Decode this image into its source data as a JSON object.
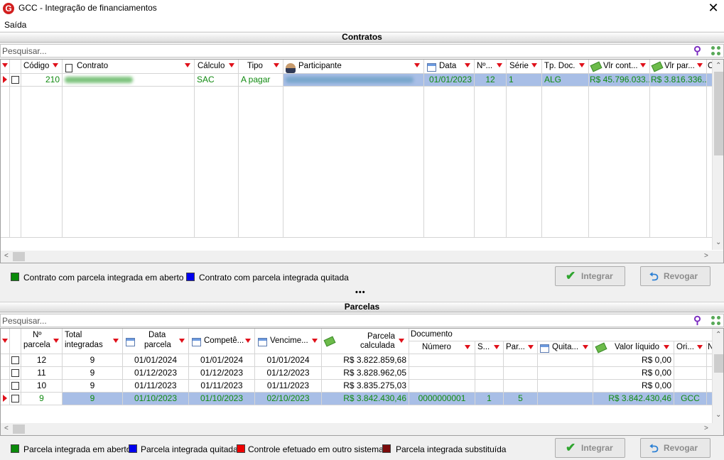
{
  "window": {
    "title": "GCC - Integração de financiamentos",
    "logo": "G",
    "close_icon": "close-icon"
  },
  "menu": {
    "saida": "Saída"
  },
  "contratos": {
    "section_title": "Contratos",
    "search_placeholder": "Pesquisar...",
    "columns": {
      "codigo": "Código",
      "contrato": "Contrato",
      "calculo": "Cálculo",
      "tipo": "Tipo",
      "participante": "Participante",
      "data": "Data",
      "num": "Nº...",
      "serie": "Série",
      "tpdoc": "Tp. Doc.",
      "vlrcont": "Vlr cont...",
      "vlrpar": "Vlr par...",
      "extra": "C"
    },
    "rows": [
      {
        "codigo": "210",
        "calculo": "SAC",
        "tipo": "A pagar",
        "data": "01/01/2023",
        "num": "12",
        "serie": "1",
        "tpdoc": "ALG",
        "vlrcont": "R$ 45.796.033...",
        "vlrpar": "R$ 3.816.336..."
      }
    ],
    "legend": [
      {
        "color": "#0a8a0a",
        "label": "Contrato com parcela integrada em aberto"
      },
      {
        "color": "#0000ee",
        "label": "Contrato com parcela integrada quitada"
      }
    ],
    "buttons": {
      "integrar": "Integrar",
      "revogar": "Revogar"
    }
  },
  "splitter": "•••",
  "parcelas": {
    "section_title": "Parcelas",
    "search_placeholder": "Pesquisar...",
    "columns": {
      "num_l1": "Nº",
      "num_l2": "parcela",
      "total_l1": "Total",
      "total_l2": "integradas",
      "data_l1": "Data",
      "data_l2": "parcela",
      "compet": "Competê...",
      "venc": "Vencime...",
      "calc_l1": "Parcela",
      "calc_l2": "calculada",
      "documento": "Documento",
      "numero": "Número",
      "s": "S...",
      "par": "Par...",
      "quita": "Quita...",
      "valor": "Valor líquido",
      "ori": "Ori...",
      "n": "N"
    },
    "rows": [
      {
        "num": "12",
        "total": "9",
        "data": "01/01/2024",
        "compet": "01/01/2024",
        "venc": "01/01/2024",
        "calc": "R$ 3.822.859,68",
        "numero": "",
        "s": "",
        "par": "",
        "valor": "R$ 0,00",
        "ori": ""
      },
      {
        "num": "11",
        "total": "9",
        "data": "01/12/2023",
        "compet": "01/12/2023",
        "venc": "01/12/2023",
        "calc": "R$ 3.828.962,05",
        "numero": "",
        "s": "",
        "par": "",
        "valor": "R$ 0,00",
        "ori": ""
      },
      {
        "num": "10",
        "total": "9",
        "data": "01/11/2023",
        "compet": "01/11/2023",
        "venc": "01/11/2023",
        "calc": "R$ 3.835.275,03",
        "numero": "",
        "s": "",
        "par": "",
        "valor": "R$ 0,00",
        "ori": ""
      },
      {
        "num": "9",
        "total": "9",
        "data": "01/10/2023",
        "compet": "01/10/2023",
        "venc": "02/10/2023",
        "calc": "R$ 3.842.430,46",
        "numero": "0000000001",
        "s": "1",
        "par": "5",
        "valor": "R$ 3.842.430,46",
        "ori": "GCC"
      }
    ],
    "legend": [
      {
        "color": "#0a8a0a",
        "label": "Parcela integrada em aberto"
      },
      {
        "color": "#0000ee",
        "label": "Parcela integrada quitada"
      },
      {
        "color": "#ee0000",
        "label": "Controle efetuado em outro sistema"
      },
      {
        "color": "#7a0a0a",
        "label": "Parcela integrada substituída"
      }
    ],
    "buttons": {
      "integrar": "Integrar",
      "revogar": "Revogar"
    }
  }
}
